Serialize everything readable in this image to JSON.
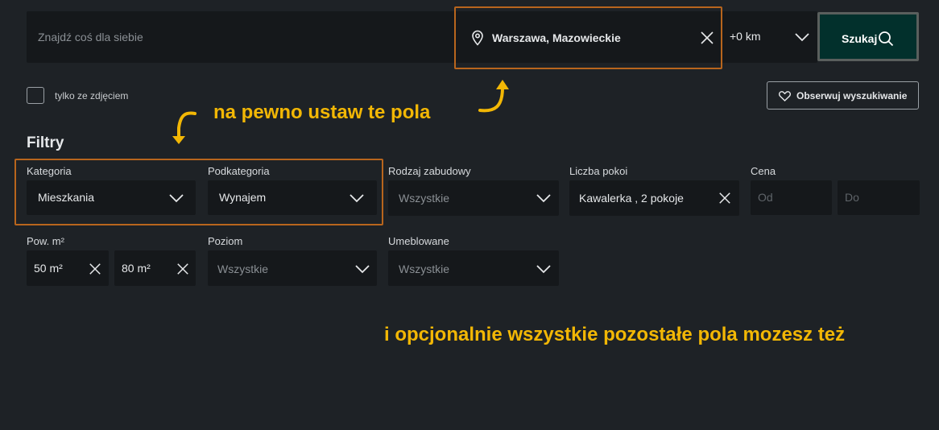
{
  "search": {
    "query_placeholder": "Znajdź coś dla siebie",
    "location_value": "Warszawa, Mazowieckie",
    "radius_value": "+0 km",
    "search_label": "Szukaj"
  },
  "options": {
    "photo_only_label": "tylko ze zdjęciem",
    "photo_only_checked": false,
    "watch_label": "Obserwuj wyszukiwanie"
  },
  "filters": {
    "heading": "Filtry",
    "kategoria": {
      "label": "Kategoria",
      "value": "Mieszkania"
    },
    "podkategoria": {
      "label": "Podkategoria",
      "value": "Wynajem"
    },
    "rodzaj": {
      "label": "Rodzaj zabudowy",
      "value": "Wszystkie"
    },
    "pokoje": {
      "label": "Liczba pokoi",
      "value": "Kawalerka , 2 pokoje"
    },
    "cena": {
      "label": "Cena",
      "from_placeholder": "Od",
      "to_placeholder": "Do"
    },
    "pow": {
      "label": "Pow. m²",
      "from_value": "50 m²",
      "to_value": "80 m²"
    },
    "poziom": {
      "label": "Poziom",
      "value": "Wszystkie"
    },
    "umeblowane": {
      "label": "Umeblowane",
      "value": "Wszystkie"
    }
  },
  "annotations": {
    "must_set": "na pewno ustaw te pola",
    "optional": "i opcjonalnie wszystkie pozostałe pola mozesz też"
  },
  "colors": {
    "background": "#1e2226",
    "field": "#15181b",
    "search_button": "#02302c",
    "highlight_box": "#b8651d",
    "annotation": "#f2b705"
  },
  "icons": [
    "location-pin-icon",
    "close-icon",
    "chevron-down-icon",
    "search-icon",
    "heart-icon",
    "arrow-icon"
  ]
}
